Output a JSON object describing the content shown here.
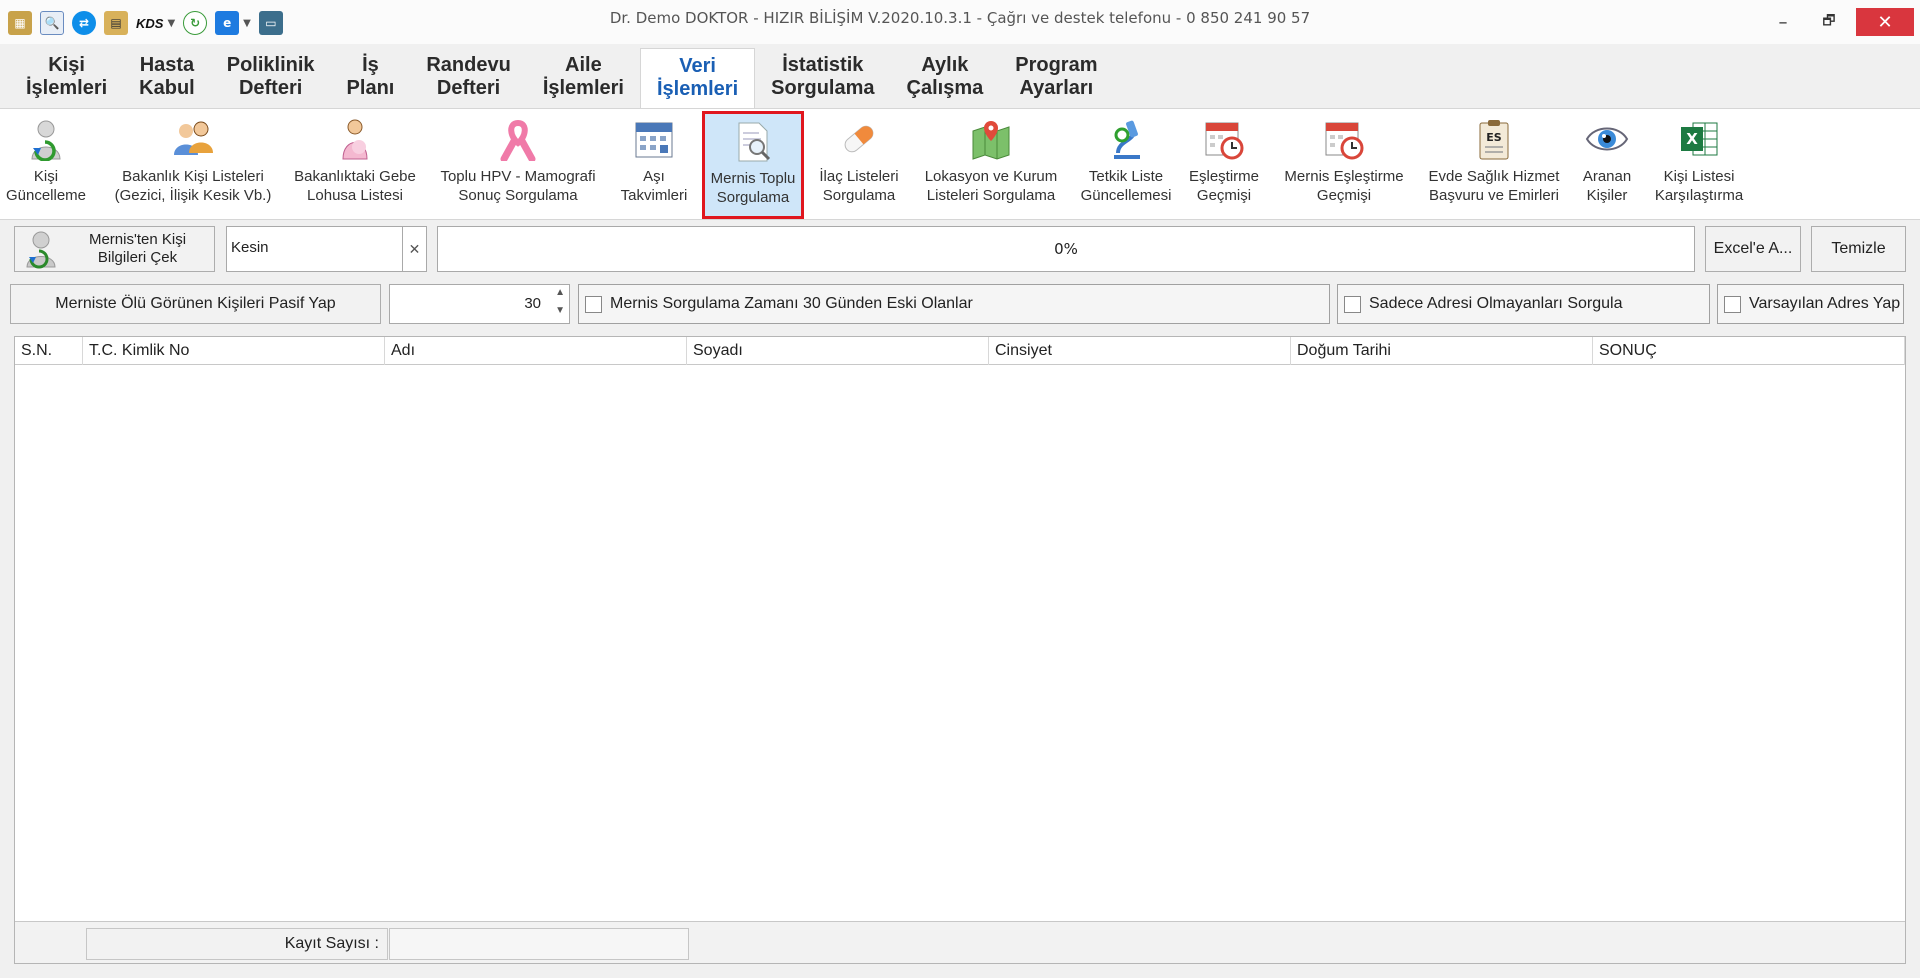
{
  "window": {
    "title": "Dr. Demo DOKTOR - HIZIR BİLİŞİM V.2020.10.3.1 - Çağrı ve destek telefonu - 0 850 241 90 57",
    "minimize_glyph": "–",
    "restore_glyph": "🗗",
    "close_glyph": "✕"
  },
  "quick_access": {
    "kds_label": "KDS",
    "icons": [
      "map-icon",
      "search-doc-icon",
      "teamviewer-icon",
      "clipboard-icon",
      "kds-icon",
      "refresh-icon",
      "browser-icon",
      "scanner-icon"
    ]
  },
  "tabs": [
    {
      "line1": "Kişi",
      "line2": "İşlemleri"
    },
    {
      "line1": "Hasta",
      "line2": "Kabul"
    },
    {
      "line1": "Poliklinik",
      "line2": "Defteri"
    },
    {
      "line1": "İş",
      "line2": "Planı"
    },
    {
      "line1": "Randevu",
      "line2": "Defteri"
    },
    {
      "line1": "Aile",
      "line2": "İşlemleri"
    },
    {
      "line1": "Veri",
      "line2": "İşlemleri"
    },
    {
      "line1": "İstatistik",
      "line2": "Sorgulama"
    },
    {
      "line1": "Aylık",
      "line2": "Çalışma"
    },
    {
      "line1": "Program",
      "line2": "Ayarları"
    }
  ],
  "active_tab_index": 6,
  "ribbon": [
    {
      "line1": "Kişi",
      "line2": "Güncelleme",
      "icon": "person-update-icon"
    },
    {
      "line1": "Bakanlık Kişi Listeleri",
      "line2": "(Gezici, İlişik Kesik Vb.)",
      "icon": "people-list-icon"
    },
    {
      "line1": "Bakanlıktaki Gebe",
      "line2": "Lohusa Listesi",
      "icon": "pregnant-icon"
    },
    {
      "line1": "Toplu HPV - Mamografi",
      "line2": "Sonuç Sorgulama",
      "icon": "pink-ribbon-icon"
    },
    {
      "line1": "Aşı",
      "line2": "Takvimleri",
      "icon": "calendar-icon"
    },
    {
      "line1": "Mernis Toplu",
      "line2": "Sorgulama",
      "icon": "doc-search-icon"
    },
    {
      "line1": "İlaç Listeleri",
      "line2": "Sorgulama",
      "icon": "pill-icon"
    },
    {
      "line1": "Lokasyon ve Kurum",
      "line2": "Listeleri Sorgulama",
      "icon": "map-pin-icon"
    },
    {
      "line1": "Tetkik Liste",
      "line2": "Güncellemesi",
      "icon": "microscope-icon"
    },
    {
      "line1": "Eşleştirme",
      "line2": "Geçmişi",
      "icon": "calendar-clock-icon"
    },
    {
      "line1": "Mernis Eşleştirme",
      "line2": "Geçmişi",
      "icon": "calendar-clock-icon"
    },
    {
      "line1": "Evde Sağlık Hizmet",
      "line2": "Başvuru ve Emirleri",
      "icon": "es-clipboard-icon"
    },
    {
      "line1": "Aranan",
      "line2": "Kişiler",
      "icon": "eye-icon"
    },
    {
      "line1": "Kişi Listesi",
      "line2": "Karşılaştırma",
      "icon": "excel-icon"
    }
  ],
  "toolbar": {
    "mernis_button_line1": "Mernis'ten Kişi",
    "mernis_button_line2": "Bilgileri Çek",
    "match_mode_value": "Kesin",
    "clear_glyph": "✕",
    "progress_text": "0%",
    "excel_button": "Excel'e A...",
    "clear_button": "Temizle",
    "passive_button": "Merniste Ölü Görünen Kişileri Pasif Yap",
    "days_value": "30",
    "older_than_label": "Mernis Sorgulama Zamanı 30 Günden Eski Olanlar",
    "no_address_label": "Sadece Adresi Olmayanları Sorgula",
    "default_address_label": "Varsayılan Adres Yap"
  },
  "grid": {
    "columns": [
      "S.N.",
      "T.C. Kimlik No",
      "Adı",
      "Soyadı",
      "Cinsiyet",
      "Doğum Tarihi",
      "SONUÇ"
    ],
    "rows": [],
    "footer_label": "Kayıt Sayısı :",
    "footer_value": ""
  }
}
